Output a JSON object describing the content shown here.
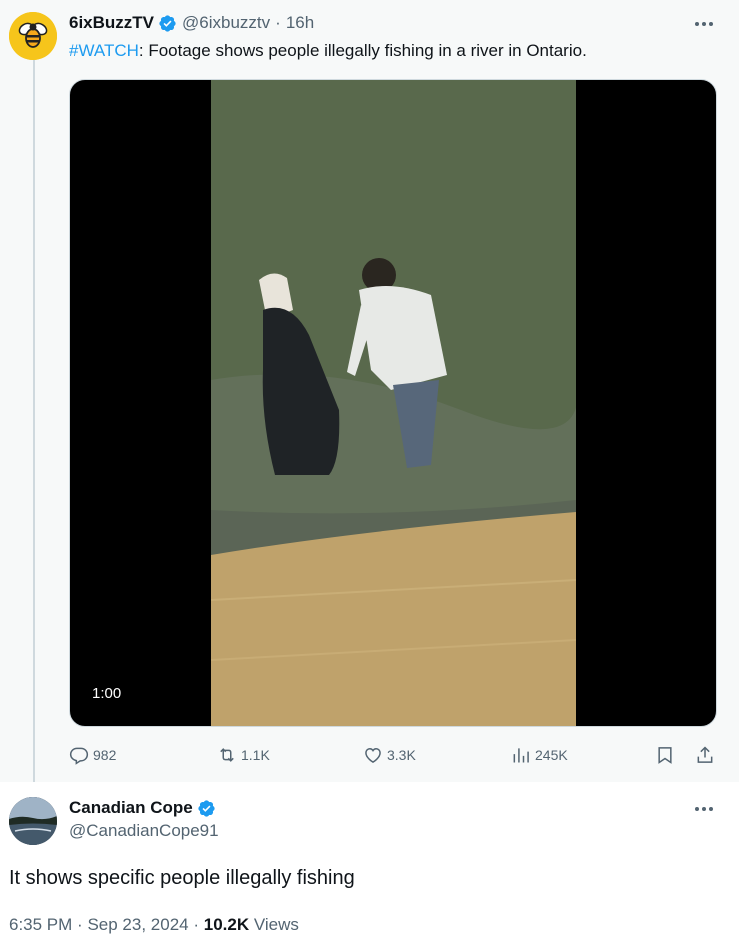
{
  "parent_tweet": {
    "display_name": "6ixBuzzTV",
    "handle": "@6ixbuzztv",
    "separator": "·",
    "time": "16h",
    "hashtag": "#WATCH",
    "text": ": Footage shows people illegally fishing in a river in Ontario.",
    "video_duration": "1:00",
    "stats": {
      "replies": "982",
      "reposts": "1.1K",
      "likes": "3.3K",
      "views": "245K"
    }
  },
  "reply_tweet": {
    "display_name": "Canadian Cope",
    "handle": "@CanadianCope91",
    "text": "It shows specific people illegally fishing",
    "time": "6:35 PM",
    "date": "Sep 23, 2024",
    "views_count": "10.2K",
    "views_label": "Views",
    "separator": "·"
  },
  "colors": {
    "verified": "#1d9bf0",
    "link": "#1d9bf0",
    "secondary_text": "#536471",
    "parent_background": "#f7f9f9"
  },
  "icons": [
    "verified-badge-icon",
    "more-icon",
    "reply-icon",
    "repost-icon",
    "like-icon",
    "views-icon",
    "bookmark-icon",
    "share-icon"
  ]
}
